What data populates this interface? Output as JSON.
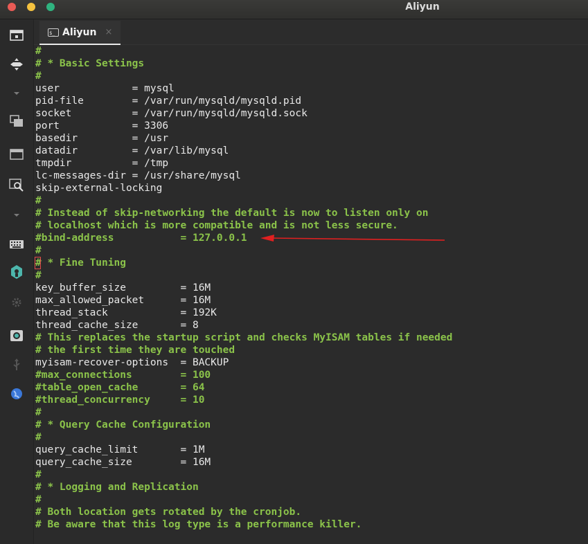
{
  "window": {
    "title": "Aliyun"
  },
  "tab": {
    "label": "Aliyun",
    "icon_text": "$_",
    "close_glyph": "×"
  },
  "sidebar": {
    "icons": [
      "terminal-window-icon",
      "move-icon",
      "chevron-down-icon",
      "windows-icon",
      "window-icon",
      "search-window-icon",
      "chevron-down-icon",
      "keyboard-icon",
      "robot-icon",
      "gear-icon",
      "camera-icon",
      "usb-icon",
      "globe-icon"
    ]
  },
  "terminal": {
    "lines": [
      {
        "text": "#",
        "type": "cmt"
      },
      {
        "text": "# * Basic Settings",
        "type": "cmt"
      },
      {
        "text": "#",
        "type": "cmt"
      },
      {
        "text": "user            = mysql",
        "type": "cfg"
      },
      {
        "text": "pid-file        = /var/run/mysqld/mysqld.pid",
        "type": "cfg"
      },
      {
        "text": "socket          = /var/run/mysqld/mysqld.sock",
        "type": "cfg"
      },
      {
        "text": "port            = 3306",
        "type": "cfg"
      },
      {
        "text": "basedir         = /usr",
        "type": "cfg"
      },
      {
        "text": "datadir         = /var/lib/mysql",
        "type": "cfg"
      },
      {
        "text": "tmpdir          = /tmp",
        "type": "cfg"
      },
      {
        "text": "lc-messages-dir = /usr/share/mysql",
        "type": "cfg"
      },
      {
        "text": "skip-external-locking",
        "type": "cfg"
      },
      {
        "text": "#",
        "type": "cmt"
      },
      {
        "text": "# Instead of skip-networking the default is now to listen only on",
        "type": "cmt"
      },
      {
        "text": "# localhost which is more compatible and is not less secure.",
        "type": "cmt"
      },
      {
        "text": "#bind-address           = 127.0.0.1",
        "type": "cmt"
      },
      {
        "text": "#",
        "type": "cmt"
      },
      {
        "text": "# * Fine Tuning",
        "type": "cmt"
      },
      {
        "text": "#",
        "type": "cmt"
      },
      {
        "text": "key_buffer_size         = 16M",
        "type": "cfg"
      },
      {
        "text": "max_allowed_packet      = 16M",
        "type": "cfg"
      },
      {
        "text": "thread_stack            = 192K",
        "type": "cfg"
      },
      {
        "text": "thread_cache_size       = 8",
        "type": "cfg"
      },
      {
        "text": "# This replaces the startup script and checks MyISAM tables if needed",
        "type": "cmt"
      },
      {
        "text": "# the first time they are touched",
        "type": "cmt"
      },
      {
        "text": "myisam-recover-options  = BACKUP",
        "type": "cfg"
      },
      {
        "text": "#max_connections        = 100",
        "type": "cmt"
      },
      {
        "text": "#table_open_cache       = 64",
        "type": "cmt"
      },
      {
        "text": "#thread_concurrency     = 10",
        "type": "cmt"
      },
      {
        "text": "#",
        "type": "cmt"
      },
      {
        "text": "# * Query Cache Configuration",
        "type": "cmt"
      },
      {
        "text": "#",
        "type": "cmt"
      },
      {
        "text": "query_cache_limit       = 1M",
        "type": "cfg"
      },
      {
        "text": "query_cache_size        = 16M",
        "type": "cfg"
      },
      {
        "text": "#",
        "type": "cmt"
      },
      {
        "text": "# * Logging and Replication",
        "type": "cmt"
      },
      {
        "text": "#",
        "type": "cmt"
      },
      {
        "text": "# Both location gets rotated by the cronjob.",
        "type": "cmt"
      },
      {
        "text": "# Be aware that this log type is a performance killer.",
        "type": "cmt"
      }
    ]
  },
  "annotation": {
    "arrow_color": "#e02020"
  },
  "colors": {
    "comment": "#8bc34a",
    "text": "#e8e8e8",
    "background": "#2b2b2b"
  }
}
